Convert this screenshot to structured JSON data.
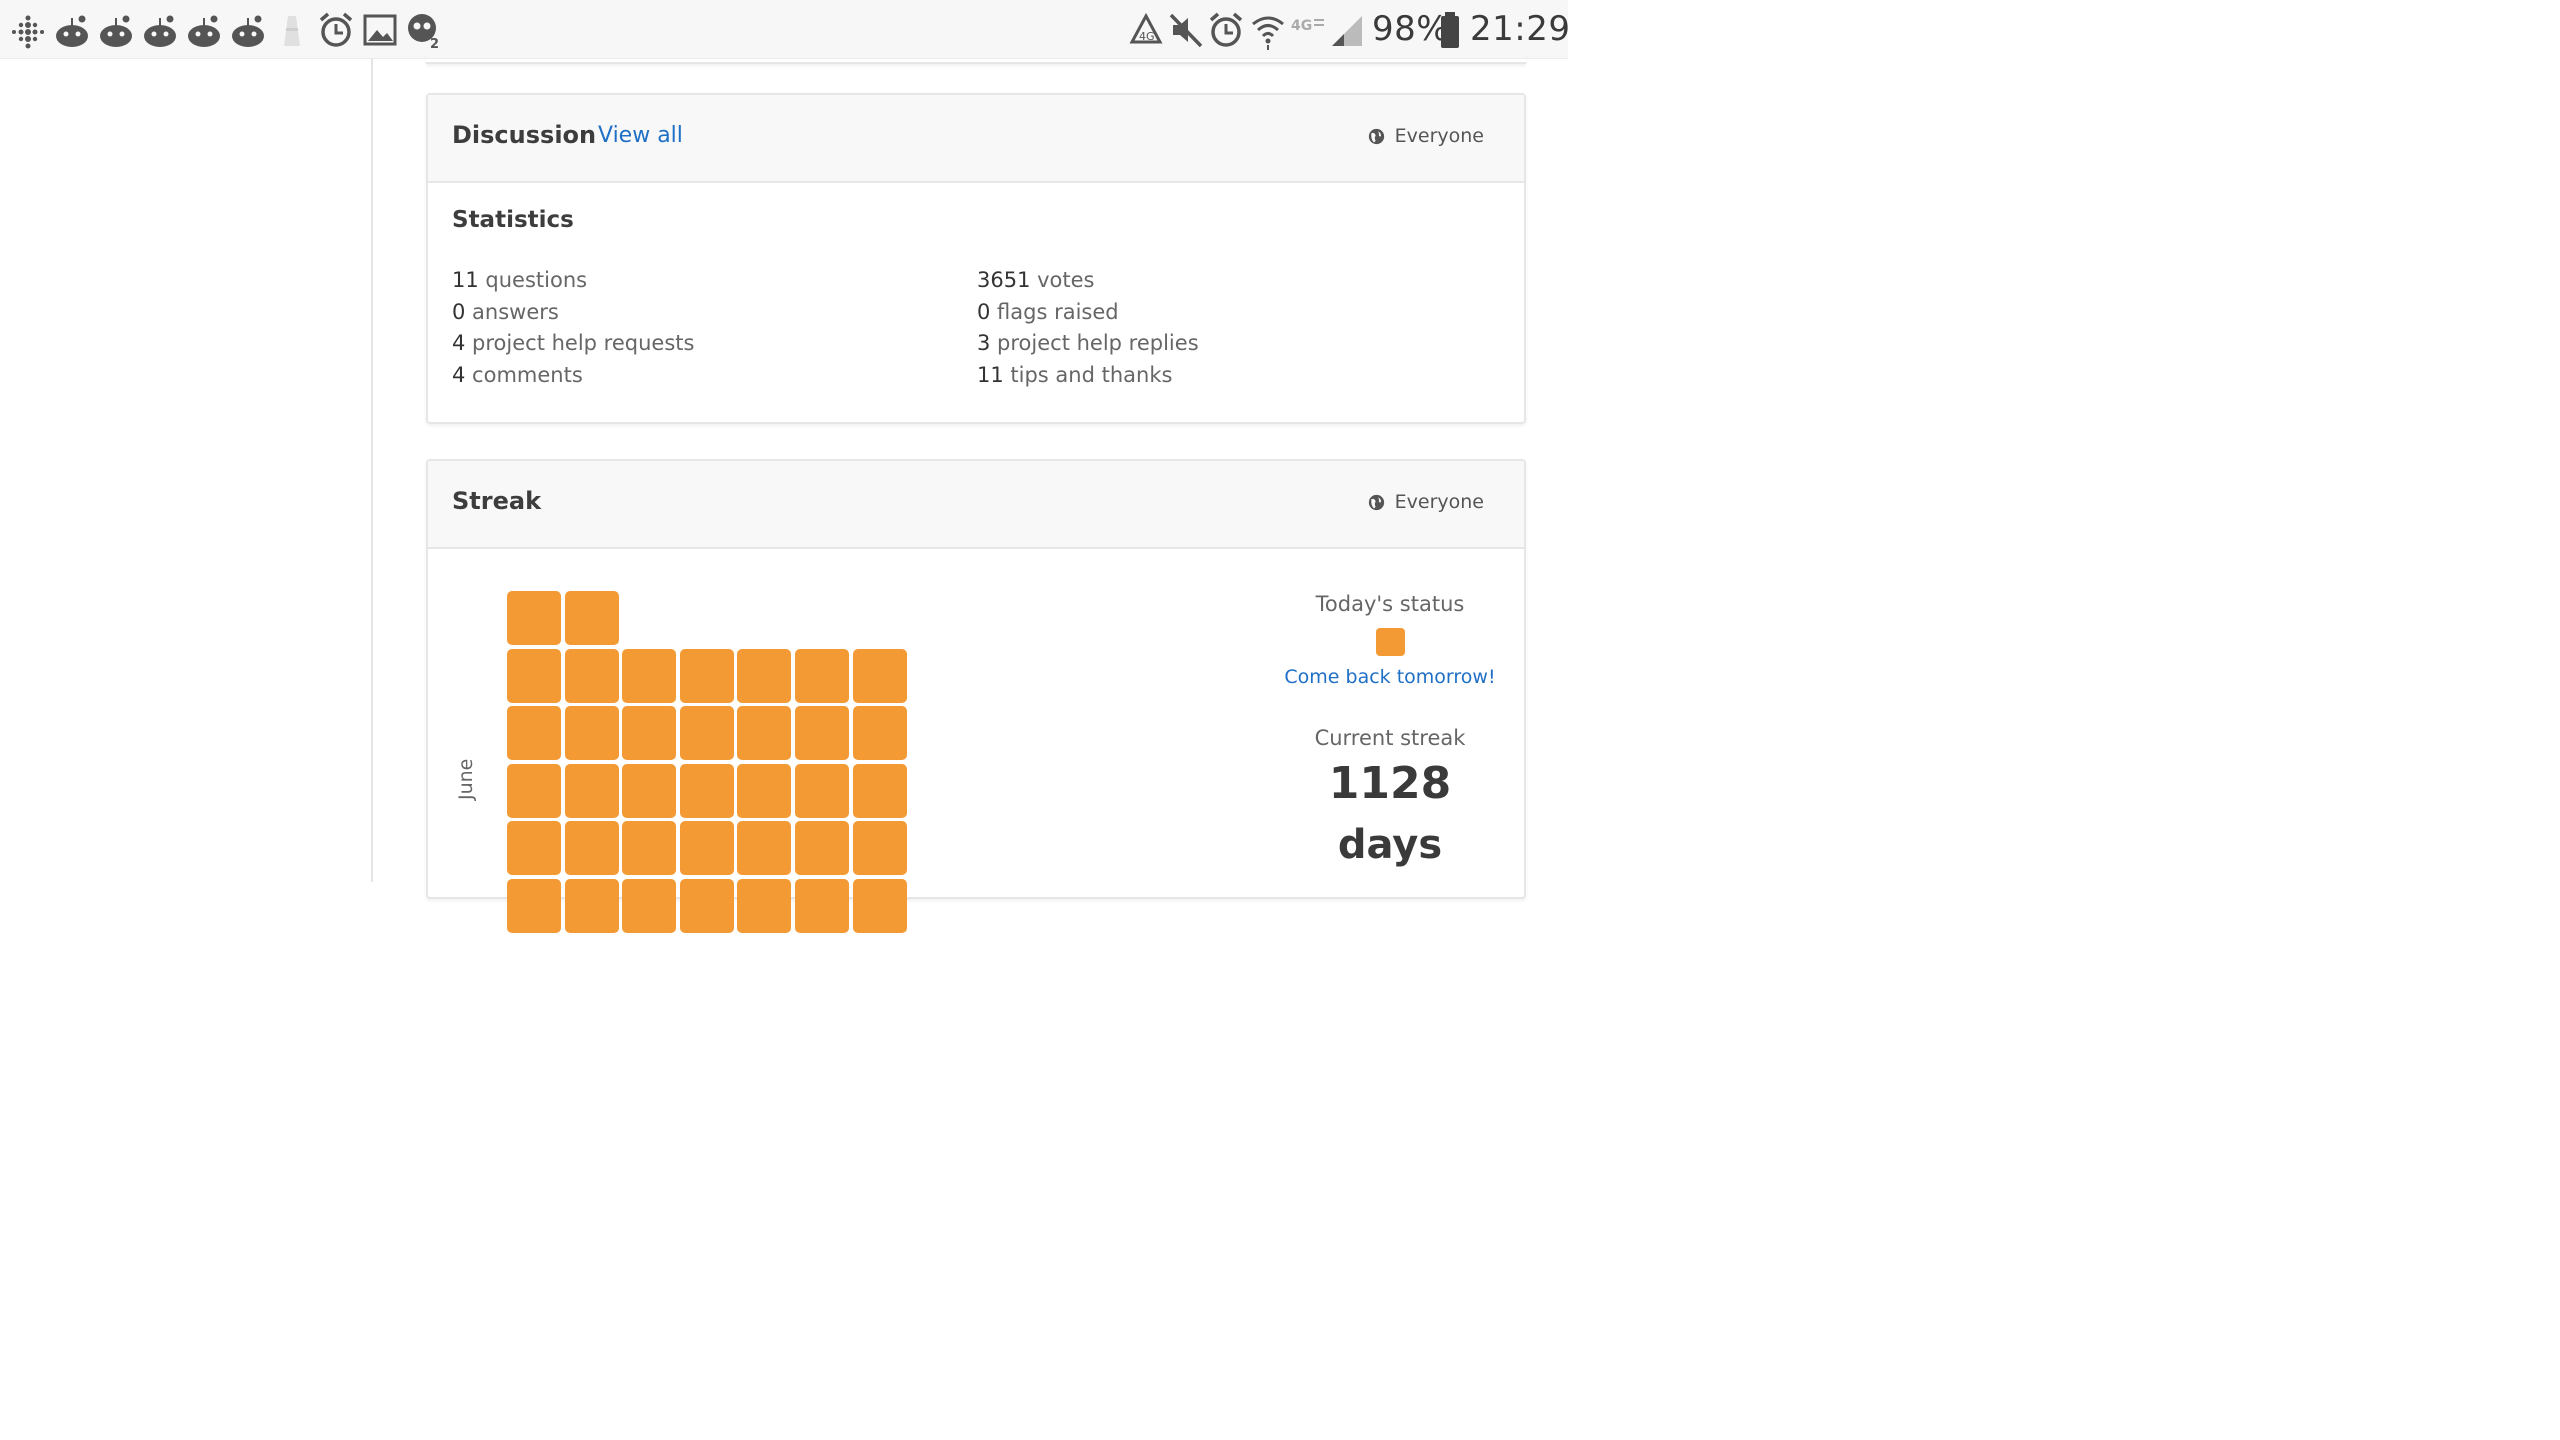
{
  "status_bar": {
    "left_icons": [
      "fitbit-icon",
      "reddit-icon",
      "reddit-icon",
      "reddit-icon",
      "reddit-icon",
      "reddit-icon",
      "tower-icon",
      "alarm-icon",
      "image-icon",
      "skull-icon"
    ],
    "right_icons": [
      "recycle-icon",
      "mute-icon",
      "alarm-icon",
      "wifi-icon",
      "4g-icon",
      "signal-icon",
      "battery-icon"
    ],
    "battery": "98%",
    "time": "21:29"
  },
  "discussion": {
    "title": "Discussion",
    "view_all": "View all",
    "visibility": "Everyone",
    "stats_title": "Statistics",
    "left": [
      {
        "num": "11",
        "label": " questions"
      },
      {
        "num": "0",
        "label": " answers"
      },
      {
        "num": "4",
        "label": " project help requests"
      },
      {
        "num": "4",
        "label": " comments"
      }
    ],
    "right": [
      {
        "num": "3651",
        "label": " votes"
      },
      {
        "num": "0",
        "label": " flags raised"
      },
      {
        "num": "3",
        "label": " project help replies"
      },
      {
        "num": "11",
        "label": " tips and thanks"
      }
    ]
  },
  "streak": {
    "title": "Streak",
    "visibility": "Everyone",
    "month": "June",
    "today_label": "Today's status",
    "come_back": "Come back tomorrow!",
    "current_label": "Current streak",
    "current_value": "1128",
    "current_unit": "days",
    "color": "#f39a34"
  }
}
